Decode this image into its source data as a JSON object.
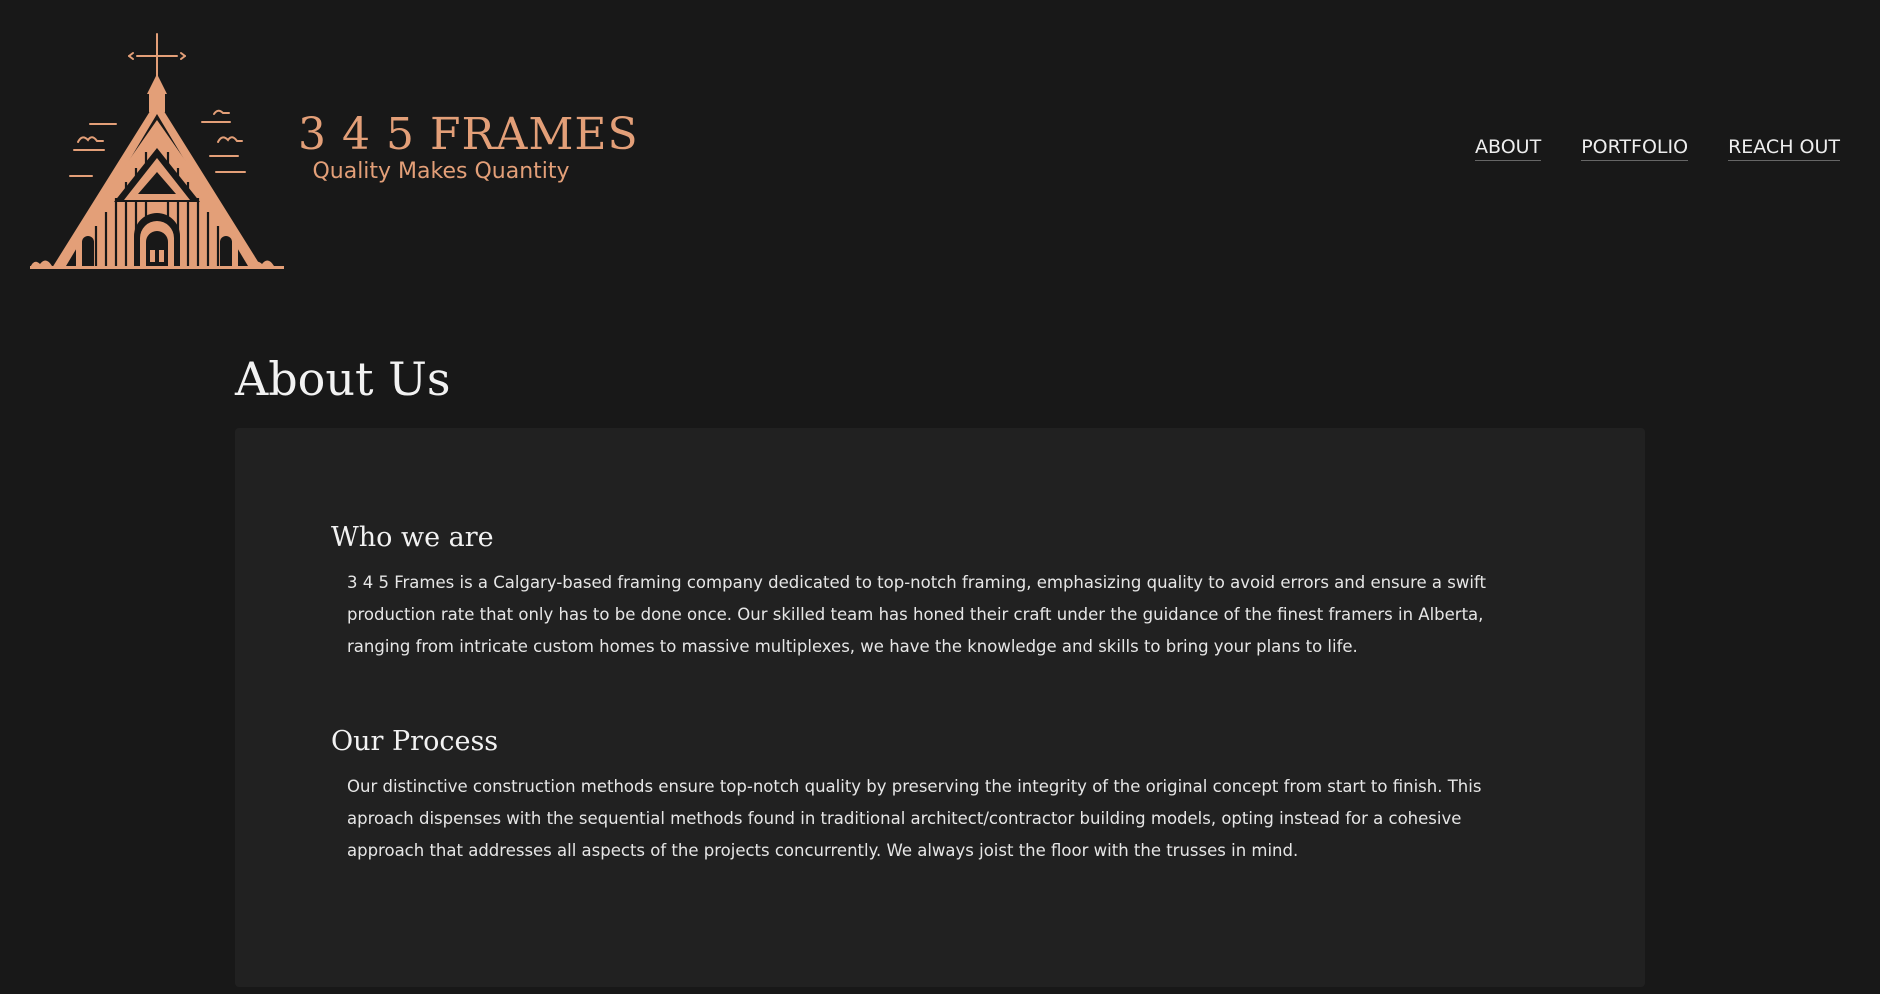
{
  "brand": {
    "name": "3 4 5 FRAMES",
    "tagline": "Quality Makes Quantity",
    "logo_icon": "church-logo-icon"
  },
  "nav": {
    "items": [
      {
        "label": "ABOUT"
      },
      {
        "label": "PORTFOLIO"
      },
      {
        "label": "REACH OUT"
      }
    ]
  },
  "page": {
    "title": "About Us"
  },
  "sections": [
    {
      "heading": "Who we are",
      "body": "3 4 5 Frames is a Calgary-based framing company dedicated to top-notch framing, emphasizing quality to avoid errors and ensure a swift production rate that only has to be done once. Our skilled team has honed their craft under the guidance of the finest framers in Alberta, ranging from intricate custom homes to massive multiplexes, we have the knowledge and skills to bring your plans to life."
    },
    {
      "heading": "Our Process",
      "body": "Our distinctive construction methods ensure top-notch quality by preserving the integrity of the original concept from start to finish. This aproach dispenses with the sequential methods found in traditional architect/contractor building models, opting instead for a cohesive approach that addresses all aspects of the projects concurrently. We always joist the floor with the trusses in mind."
    }
  ],
  "colors": {
    "background": "#181818",
    "card": "#212121",
    "accent": "#e39f78",
    "text": "#eaeaea"
  }
}
